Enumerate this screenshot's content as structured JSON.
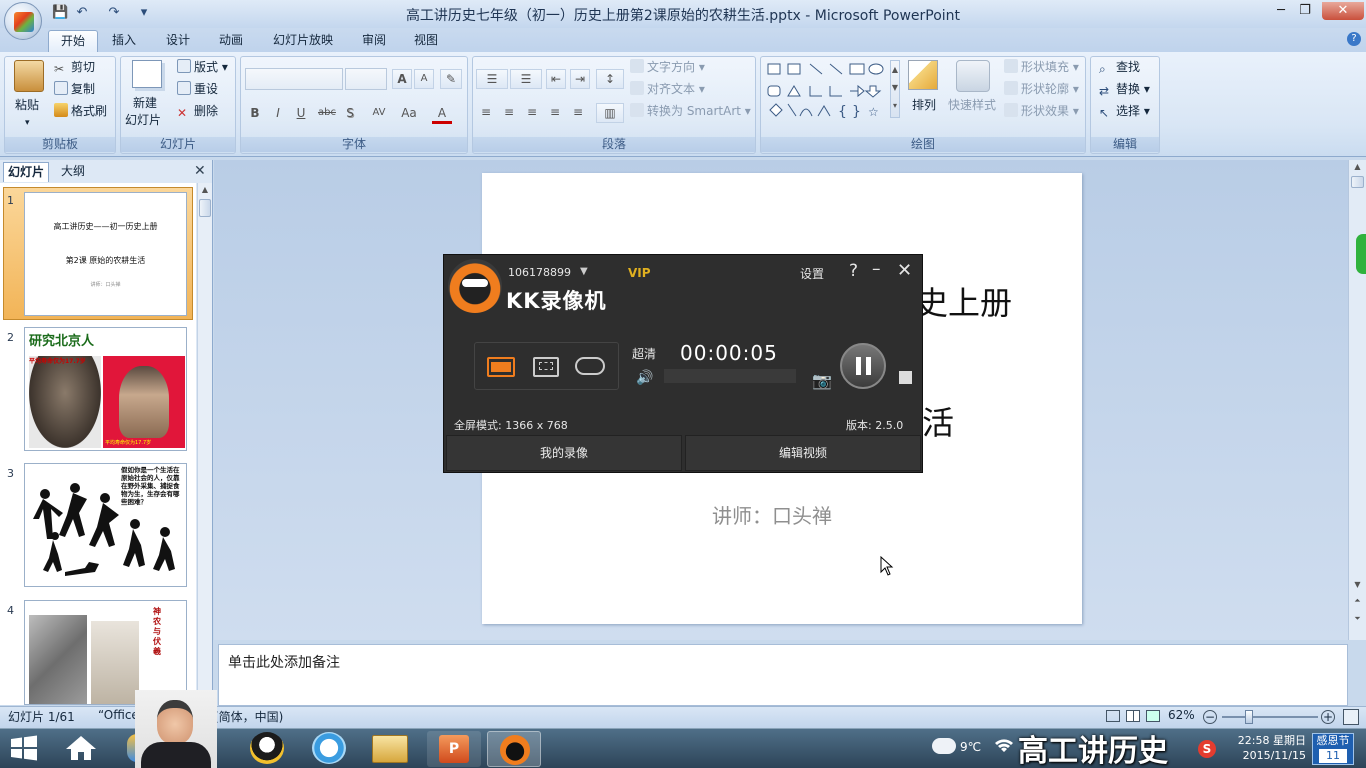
{
  "window": {
    "title": "高工讲历史七年级（初一）历史上册第2课原始的农耕生活.pptx - Microsoft PowerPoint",
    "controls": [
      "─",
      "❐",
      "✕"
    ]
  },
  "tabs": [
    "开始",
    "插入",
    "设计",
    "动画",
    "幻灯片放映",
    "审阅",
    "视图"
  ],
  "ribbon": {
    "clipboard": {
      "paste": "粘贴",
      "cut": "剪切",
      "copy": "复制",
      "format_painter": "格式刷",
      "label": "剪贴板"
    },
    "slides": {
      "new_slide": "新建",
      "new_slide2": "幻灯片",
      "layout": "版式",
      "reset": "重设",
      "delete": "删除",
      "label": "幻灯片"
    },
    "font": {
      "label": "字体",
      "bold": "B",
      "italic": "I",
      "underline": "U",
      "strike": "abc",
      "shadow": "S",
      "spacing": "AV",
      "case": "Aa",
      "color": "A",
      "grow": "A",
      "shrink": "A"
    },
    "paragraph": {
      "text_direction": "文字方向",
      "align_text": "对齐文本",
      "smartart": "转换为 SmartArt",
      "label": "段落"
    },
    "drawing": {
      "arrange": "排列",
      "quick_styles": "快速样式",
      "fill": "形状填充",
      "outline": "形状轮廓",
      "effects": "形状效果",
      "label": "绘图"
    },
    "editing": {
      "find": "查找",
      "replace": "替换",
      "select": "选择",
      "label": "编辑"
    }
  },
  "left_pane": {
    "tab_slides": "幻灯片",
    "tab_outline": "大纲",
    "close": "✕",
    "thumbnails": [
      {
        "num": "1",
        "line1": "高工讲历史——初一历史上册",
        "line2": "第2课 原始的农耕生活",
        "line3": "讲师：口头禅"
      },
      {
        "num": "2",
        "title": "研究北京人",
        "cap1": "平均寿命仅为17.7岁",
        "cap2": "平均寿命仅为17.7岁"
      },
      {
        "num": "3",
        "text": "假如你是一个生活在原始社会的人，仅靠在野外采集、捕捉食物为生，生存会有哪些困难？"
      },
      {
        "num": "4",
        "text": "神农与伏羲"
      }
    ]
  },
  "slide": {
    "title_visible": "史上册",
    "subtitle_visible": "活",
    "speaker": "讲师：口头禅"
  },
  "notes": {
    "placeholder": "单击此处添加备注"
  },
  "status": {
    "slide_index": "幻灯片 1/61",
    "theme": "“Office",
    "language": "(简体，中国)",
    "zoom": "62%"
  },
  "recorder": {
    "account": "106178899",
    "vip": "VIP",
    "settings": "设置",
    "help": "?",
    "title": "KK录像机",
    "quality": "超清",
    "timer": "00:00:05",
    "mode": "全屏模式: 1366 x 768",
    "version": "版本: 2.5.0",
    "my_videos": "我的录像",
    "edit_video": "编辑视频"
  },
  "taskbar": {
    "weather": "9℃",
    "watermark": "高工讲历史",
    "time": "22:58 星期日",
    "date": "2015/11/15",
    "festival": "感恩节",
    "day": "11"
  },
  "colors": {
    "ribbon_bg": "#dfeaf7",
    "accent_orange": "#f07d1e",
    "recorder_bg": "#2e2e2e",
    "vip": "#e0b020"
  }
}
